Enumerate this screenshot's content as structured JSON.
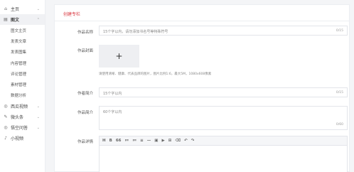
{
  "sidebar": {
    "items": [
      {
        "label": "主页",
        "icon": "home-icon",
        "glyph": "⌂",
        "chev": "⌄"
      },
      {
        "label": "图文",
        "icon": "image-text-icon",
        "glyph": "▤",
        "chev": "⌃",
        "active": true
      }
    ],
    "sub_items": [
      "图文主页",
      "发表文章",
      "发表图集",
      "内容管理",
      "评论管理",
      "素材管理",
      "数据分析"
    ],
    "bottom_items": [
      {
        "label": "西瓜视频",
        "icon": "video-icon",
        "glyph": "◎",
        "chev": "⌄"
      },
      {
        "label": "微头条",
        "icon": "microblog-icon",
        "glyph": "✎",
        "chev": "⌄"
      },
      {
        "label": "悟空问答",
        "icon": "qa-icon",
        "glyph": "◎",
        "chev": "⌄"
      },
      {
        "label": "小视频",
        "icon": "short-video-icon",
        "glyph": "♪"
      }
    ]
  },
  "main": {
    "tab_label": "创建专栏",
    "title_field": {
      "label": "作品名称",
      "placeholder": "15个字以内，请勿添加书名号等特殊符号",
      "count": "0/15"
    },
    "cover_field": {
      "label": "作品封面",
      "plus": "+",
      "hint": "请使用清晰、健康、代表品牌的图片，图片比例1:6，最大5M，1080x608像素"
    },
    "author_intro": {
      "label": "作者简介",
      "placeholder": "15个字以内",
      "count": "0/15"
    },
    "work_intro": {
      "label": "作品简介",
      "placeholder": "60个字以内",
      "count": "0/60"
    },
    "details": {
      "label": "作品详情"
    },
    "toolbar": [
      "H",
      "B",
      "66",
      "≔",
      "≔",
      "≡",
      "—",
      "▣",
      "▶",
      "⊞",
      "⌫",
      "↶",
      "↷"
    ]
  }
}
